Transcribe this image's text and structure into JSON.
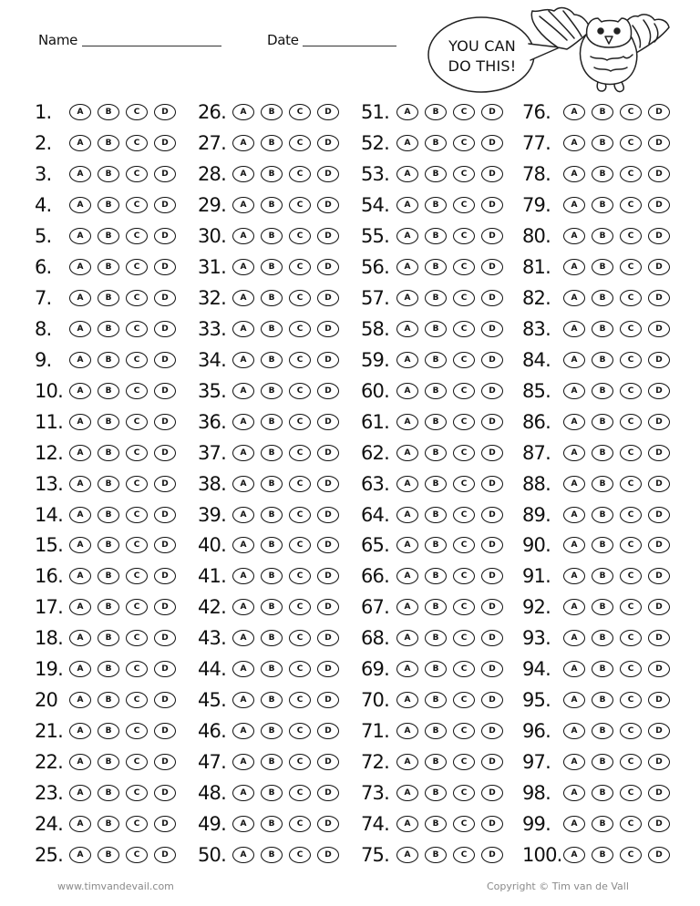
{
  "header": {
    "name_label": "Name",
    "name_value": "",
    "date_label": "Date",
    "date_value": ""
  },
  "mascot": {
    "speech_line1": "YOU CAN",
    "speech_line2": "DO THIS!",
    "icon": "owl-icon"
  },
  "answer_options": [
    "A",
    "B",
    "C",
    "D"
  ],
  "columns": [
    {
      "labels": [
        "1.",
        "2.",
        "3.",
        "4.",
        "5.",
        "6.",
        "7.",
        "8.",
        "9.",
        "10.",
        "11.",
        "12.",
        "13.",
        "14.",
        "15.",
        "16.",
        "17.",
        "18.",
        "19.",
        "20",
        "21.",
        "22.",
        "23.",
        "24.",
        "25."
      ]
    },
    {
      "labels": [
        "26.",
        "27.",
        "28.",
        "29.",
        "30.",
        "31.",
        "32.",
        "33.",
        "34.",
        "35.",
        "36.",
        "37.",
        "38.",
        "39.",
        "40.",
        "41.",
        "42.",
        "43.",
        "44.",
        "45.",
        "46.",
        "47.",
        "48.",
        "49.",
        "50."
      ]
    },
    {
      "labels": [
        "51.",
        "52.",
        "53.",
        "54.",
        "55.",
        "56.",
        "57.",
        "58.",
        "59.",
        "60.",
        "61.",
        "62.",
        "63.",
        "64.",
        "65.",
        "66.",
        "67.",
        "68.",
        "69.",
        "70.",
        "71.",
        "72.",
        "73.",
        "74.",
        "75."
      ]
    },
    {
      "labels": [
        "76.",
        "77.",
        "78.",
        "79.",
        "80.",
        "81.",
        "82.",
        "83.",
        "84.",
        "85.",
        "86.",
        "87.",
        "88.",
        "89.",
        "90.",
        "91.",
        "92.",
        "93.",
        "94.",
        "95.",
        "96.",
        "97.",
        "98.",
        "99.",
        "100."
      ]
    }
  ],
  "footer": {
    "website": "www.timvandevail.com",
    "copyright": "Copyright © Tim van de Vall"
  }
}
